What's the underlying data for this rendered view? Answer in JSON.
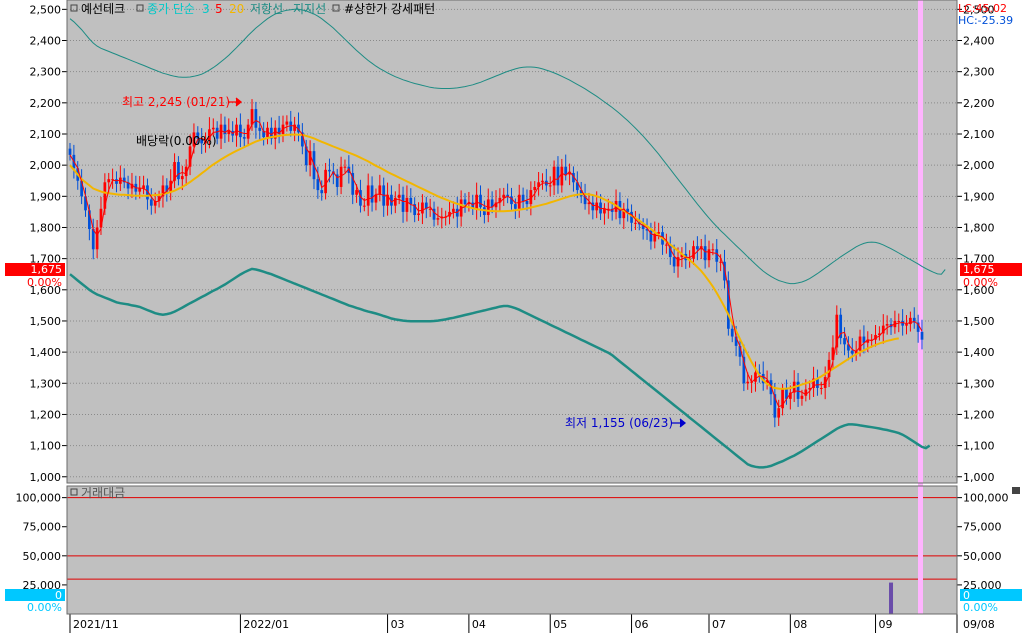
{
  "legend": {
    "title": "예선테크",
    "ma_label": "종가 단순",
    "ma_periods": [
      "3",
      "5",
      "20"
    ],
    "resistance": "저항선",
    "support": "지지선",
    "pattern": "#상한가 강세패턴"
  },
  "readout": {
    "lc": "LC:45.02",
    "hc": "HC:-25.39"
  },
  "current_price": {
    "value": "1,675",
    "change": "0.00%"
  },
  "annotations": {
    "high": "최고 2,245 (01/21)",
    "low": "최저 1,155 (06/23)",
    "dividend": "배당락(0.00%)"
  },
  "sub_panel": {
    "title": "거래대금",
    "current_value": "0",
    "current_change": "0.00%"
  },
  "colors": {
    "background": "#c0c0c0",
    "up": "#ff0000",
    "down": "#0050d8",
    "ma3": "#ff0000",
    "ma20": "#f2b600",
    "band": "#1e8c84",
    "highlight": "#ffb4ff",
    "price_tag": "#ff0000",
    "sub_tag": "#00c8ff"
  },
  "chart_data": [
    {
      "type": "candlestick",
      "title": "예선테크",
      "ylim": [
        980,
        2530
      ],
      "y_ticks": [
        "2,500",
        "2,400",
        "2,300",
        "2,200",
        "2,100",
        "2,000",
        "1,900",
        "1,800",
        "1,700",
        "1,600",
        "1,500",
        "1,400",
        "1,300",
        "1,200",
        "1,100",
        "1,000"
      ],
      "x_ticks": [
        "2021/11",
        "2022/01",
        "03",
        "04",
        "05",
        "06",
        "07",
        "08",
        "09",
        "09/08"
      ],
      "dates": [
        "2021-11-01",
        "2021-11-02",
        "2021-11-03",
        "2021-11-04",
        "2021-11-05",
        "2021-11-08",
        "2021-11-09",
        "2021-11-10",
        "2021-11-11",
        "2021-11-12",
        "2021-11-15",
        "2021-11-16",
        "2021-11-17",
        "2021-11-18",
        "2021-11-19",
        "2021-11-22",
        "2021-11-23",
        "2021-11-24",
        "2021-11-25",
        "2021-11-26",
        "2021-11-29",
        "2021-11-30",
        "2021-12-01",
        "2021-12-02",
        "2021-12-03",
        "2021-12-06",
        "2021-12-07",
        "2021-12-08",
        "2021-12-09",
        "2021-12-10",
        "2021-12-13",
        "2021-12-14",
        "2021-12-15",
        "2021-12-16",
        "2021-12-17",
        "2021-12-20",
        "2021-12-21",
        "2021-12-22",
        "2021-12-23",
        "2021-12-24",
        "2021-12-27",
        "2021-12-28",
        "2021-12-29",
        "2021-12-30",
        "2022-01-03",
        "2022-01-04",
        "2022-01-05",
        "2022-01-06",
        "2022-01-07",
        "2022-01-10",
        "2022-01-11",
        "2022-01-12",
        "2022-01-13",
        "2022-01-14",
        "2022-01-17",
        "2022-01-18",
        "2022-01-19",
        "2022-01-20",
        "2022-01-21",
        "2022-01-24",
        "2022-01-25",
        "2022-01-26",
        "2022-01-27",
        "2022-01-28",
        "2022-02-03",
        "2022-02-04",
        "2022-02-07",
        "2022-02-08",
        "2022-02-09",
        "2022-02-10",
        "2022-02-11",
        "2022-02-14",
        "2022-02-15",
        "2022-02-16",
        "2022-02-17",
        "2022-02-18",
        "2022-02-21",
        "2022-02-22",
        "2022-02-23",
        "2022-02-24",
        "2022-02-25",
        "2022-02-28",
        "2022-03-02",
        "2022-03-03",
        "2022-03-04",
        "2022-03-07",
        "2022-03-08",
        "2022-03-10",
        "2022-03-11",
        "2022-03-14",
        "2022-03-15",
        "2022-03-16",
        "2022-03-17",
        "2022-03-18",
        "2022-03-21",
        "2022-03-22",
        "2022-03-23",
        "2022-03-24",
        "2022-03-25",
        "2022-03-28",
        "2022-03-29",
        "2022-03-30",
        "2022-03-31",
        "2022-04-01",
        "2022-04-04",
        "2022-04-05",
        "2022-04-06",
        "2022-04-07",
        "2022-04-08",
        "2022-04-11",
        "2022-04-12",
        "2022-04-13",
        "2022-04-14",
        "2022-04-15",
        "2022-04-18",
        "2022-04-19",
        "2022-04-20",
        "2022-04-21",
        "2022-04-22",
        "2022-04-25",
        "2022-04-26",
        "2022-04-27",
        "2022-04-28",
        "2022-04-29",
        "2022-05-02",
        "2022-05-03",
        "2022-05-04",
        "2022-05-06",
        "2022-05-09",
        "2022-05-10",
        "2022-05-11",
        "2022-05-12",
        "2022-05-13",
        "2022-05-16",
        "2022-05-17",
        "2022-05-18",
        "2022-05-19",
        "2022-05-20",
        "2022-05-23",
        "2022-05-24",
        "2022-05-25",
        "2022-05-26",
        "2022-05-27",
        "2022-05-30",
        "2022-05-31",
        "2022-06-02",
        "2022-06-03",
        "2022-06-07",
        "2022-06-08",
        "2022-06-09",
        "2022-06-10",
        "2022-06-13",
        "2022-06-14",
        "2022-06-15",
        "2022-06-16",
        "2022-06-17",
        "2022-06-20",
        "2022-06-21",
        "2022-06-22",
        "2022-06-23",
        "2022-06-24",
        "2022-06-27",
        "2022-06-28",
        "2022-06-29",
        "2022-06-30",
        "2022-07-01",
        "2022-07-04",
        "2022-07-05",
        "2022-07-06",
        "2022-07-07",
        "2022-07-08",
        "2022-07-11",
        "2022-07-12",
        "2022-07-13",
        "2022-07-14",
        "2022-07-15",
        "2022-07-18",
        "2022-07-19",
        "2022-07-20",
        "2022-07-21",
        "2022-07-22",
        "2022-07-25",
        "2022-07-26",
        "2022-07-27",
        "2022-07-28",
        "2022-07-29",
        "2022-08-01",
        "2022-08-02",
        "2022-08-03",
        "2022-08-04",
        "2022-08-05",
        "2022-08-08",
        "2022-08-09",
        "2022-08-10",
        "2022-08-11",
        "2022-08-12",
        "2022-08-16",
        "2022-08-17",
        "2022-08-18",
        "2022-08-19",
        "2022-08-22",
        "2022-08-23",
        "2022-08-24",
        "2022-08-25",
        "2022-08-26",
        "2022-08-29",
        "2022-08-30",
        "2022-08-31",
        "2022-09-01",
        "2022-09-02",
        "2022-09-05",
        "2022-09-06",
        "2022-09-07",
        "2022-09-08"
      ],
      "close": [
        2033,
        1990,
        1950,
        1900,
        1855,
        1795,
        1730,
        1800,
        1860,
        1945,
        1955,
        1955,
        1940,
        1960,
        1945,
        1925,
        1940,
        1915,
        1925,
        1935,
        1890,
        1870,
        1885,
        1900,
        1935,
        1915,
        1950,
        2010,
        1955,
        1965,
        1995,
        2060,
        2105,
        2085,
        2070,
        2080,
        2115,
        2120,
        2085,
        2130,
        2100,
        2110,
        2095,
        2130,
        2090,
        2085,
        2130,
        2180,
        2120,
        2110,
        2090,
        2120,
        2085,
        2120,
        2100,
        2130,
        2140,
        2110,
        2130,
        2105,
        2060,
        2000,
        2045,
        1955,
        1920,
        1910,
        1985,
        1980,
        1970,
        1930,
        1995,
        1995,
        1975,
        1905,
        1920,
        1870,
        1870,
        1935,
        1880,
        1905,
        1935,
        1870,
        1905,
        1870,
        1895,
        1905,
        1850,
        1895,
        1875,
        1840,
        1845,
        1880,
        1860,
        1860,
        1825,
        1830,
        1835,
        1835,
        1850,
        1860,
        1835,
        1890,
        1875,
        1880,
        1860,
        1905,
        1865,
        1840,
        1890,
        1865,
        1880,
        1895,
        1905,
        1900,
        1875,
        1860,
        1905,
        1885,
        1875,
        1920,
        1930,
        1945,
        1950,
        1935,
        1935,
        1995,
        1935,
        1995,
        1970,
        1975,
        1945,
        1920,
        1900,
        1875,
        1880,
        1855,
        1880,
        1845,
        1860,
        1860,
        1850,
        1885,
        1830,
        1860,
        1850,
        1815,
        1815,
        1810,
        1795,
        1790,
        1755,
        1780,
        1785,
        1745,
        1745,
        1705,
        1675,
        1705,
        1715,
        1695,
        1700,
        1740,
        1730,
        1740,
        1695,
        1730,
        1730,
        1690,
        1690,
        1630,
        1475,
        1450,
        1420,
        1385,
        1300,
        1305,
        1305,
        1335,
        1330,
        1300,
        1310,
        1265,
        1190,
        1220,
        1280,
        1250,
        1270,
        1305,
        1250,
        1260,
        1280,
        1285,
        1315,
        1285,
        1285,
        1320,
        1375,
        1415,
        1520,
        1445,
        1425,
        1405,
        1395,
        1405,
        1450,
        1430,
        1440,
        1440,
        1455,
        1460,
        1485,
        1490,
        1480,
        1500,
        1500,
        1485,
        1490,
        1510,
        1495,
        1465,
        1440
      ],
      "ma20": [
        2000,
        1985,
        1970,
        1955,
        1945,
        1935,
        1925,
        1920,
        1915,
        1912,
        1910,
        1908,
        1906,
        1905,
        1905,
        1904,
        1903,
        1902,
        1902,
        1902,
        1902,
        1903,
        1904,
        1905,
        1907,
        1910,
        1914,
        1918,
        1924,
        1930,
        1938,
        1946,
        1955,
        1964,
        1974,
        1983,
        1993,
        2002,
        2010,
        2018,
        2026,
        2033,
        2040,
        2046,
        2052,
        2058,
        2064,
        2070,
        2076,
        2080,
        2084,
        2087,
        2090,
        2092,
        2094,
        2096,
        2097,
        2098,
        2098,
        2098,
        2097,
        2094,
        2090,
        2086,
        2080,
        2075,
        2070,
        2065,
        2060,
        2055,
        2050,
        2045,
        2040,
        2035,
        2030,
        2024,
        2018,
        2012,
        2005,
        1998,
        1992,
        1985,
        1978,
        1972,
        1966,
        1960,
        1954,
        1948,
        1942,
        1936,
        1930,
        1924,
        1918,
        1912,
        1906,
        1900,
        1895,
        1890,
        1885,
        1880,
        1876,
        1872,
        1868,
        1865,
        1862,
        1859,
        1857,
        1855,
        1854,
        1853,
        1852,
        1852,
        1852,
        1853,
        1854,
        1855,
        1857,
        1859,
        1861,
        1864,
        1867,
        1870,
        1873,
        1876,
        1880,
        1884,
        1888,
        1892,
        1896,
        1900,
        1903,
        1905,
        1907,
        1907,
        1906,
        1904,
        1900,
        1896,
        1890,
        1884,
        1878,
        1870,
        1862,
        1854,
        1846,
        1838,
        1830,
        1822,
        1813,
        1804,
        1795,
        1785,
        1775,
        1765,
        1755,
        1745,
        1735,
        1725,
        1715,
        1705,
        1695,
        1685,
        1673,
        1660,
        1645,
        1628,
        1610,
        1590,
        1568,
        1545,
        1520,
        1494,
        1468,
        1442,
        1416,
        1392,
        1368,
        1346,
        1326,
        1310,
        1298,
        1290,
        1285,
        1283,
        1282,
        1283,
        1285,
        1288,
        1292,
        1296,
        1300,
        1304,
        1309,
        1315,
        1322,
        1330,
        1338,
        1346,
        1354,
        1362,
        1370,
        1378,
        1386,
        1393,
        1400,
        1406,
        1412,
        1418,
        1423,
        1428,
        1432,
        1436,
        1439,
        1442,
        1444
      ],
      "band_upper": [
        2470,
        2460,
        2448,
        2435,
        2420,
        2405,
        2392,
        2382,
        2375,
        2370,
        2365,
        2360,
        2355,
        2350,
        2345,
        2340,
        2335,
        2330,
        2325,
        2320,
        2315,
        2310,
        2305,
        2300,
        2295,
        2292,
        2288,
        2285,
        2283,
        2282,
        2282,
        2283,
        2285,
        2288,
        2292,
        2298,
        2305,
        2313,
        2322,
        2332,
        2342,
        2353,
        2365,
        2377,
        2390,
        2403,
        2416,
        2428,
        2440,
        2450,
        2460,
        2470,
        2478,
        2485,
        2490,
        2494,
        2497,
        2499,
        2500,
        2500,
        2498,
        2495,
        2490,
        2485,
        2478,
        2470,
        2460,
        2450,
        2440,
        2428,
        2416,
        2404,
        2392,
        2380,
        2368,
        2357,
        2346,
        2336,
        2327,
        2318,
        2310,
        2303,
        2296,
        2290,
        2284,
        2279,
        2274,
        2270,
        2266,
        2262,
        2259,
        2256,
        2253,
        2250,
        2248,
        2247,
        2246,
        2246,
        2246,
        2247,
        2248,
        2250,
        2252,
        2255,
        2258,
        2262,
        2266,
        2271,
        2276,
        2281,
        2286,
        2291,
        2296,
        2301,
        2305,
        2309,
        2312,
        2314,
        2315,
        2315,
        2314,
        2312,
        2309,
        2305,
        2301,
        2296,
        2291,
        2285,
        2279,
        2273,
        2266,
        2259,
        2252,
        2245,
        2237,
        2229,
        2221,
        2212,
        2203,
        2194,
        2185,
        2175,
        2165,
        2154,
        2143,
        2131,
        2119,
        2106,
        2093,
        2079,
        2065,
        2050,
        2035,
        2019,
        2003,
        1987,
        1971,
        1955,
        1939,
        1923,
        1907,
        1891,
        1875,
        1860,
        1845,
        1830,
        1816,
        1803,
        1790,
        1778,
        1766,
        1754,
        1742,
        1730,
        1718,
        1706,
        1694,
        1682,
        1671,
        1660,
        1651,
        1643,
        1636,
        1630,
        1626,
        1622,
        1620,
        1620,
        1622,
        1625,
        1630,
        1636,
        1644,
        1652,
        1661,
        1670,
        1679,
        1688,
        1697,
        1706,
        1714,
        1722,
        1730,
        1738,
        1744,
        1749,
        1752,
        1753,
        1752,
        1749,
        1744,
        1738,
        1732,
        1725,
        1718,
        1711,
        1704,
        1697,
        1690,
        1683,
        1675,
        1668,
        1662,
        1656,
        1651,
        1650,
        1665
      ],
      "band_lower": [
        1650,
        1640,
        1630,
        1620,
        1610,
        1600,
        1592,
        1585,
        1580,
        1575,
        1570,
        1565,
        1560,
        1557,
        1555,
        1553,
        1550,
        1548,
        1545,
        1540,
        1535,
        1530,
        1525,
        1522,
        1520,
        1522,
        1525,
        1530,
        1536,
        1543,
        1550,
        1557,
        1563,
        1570,
        1577,
        1583,
        1590,
        1597,
        1603,
        1610,
        1617,
        1625,
        1633,
        1641,
        1649,
        1656,
        1662,
        1667,
        1665,
        1662,
        1658,
        1654,
        1650,
        1645,
        1640,
        1635,
        1630,
        1625,
        1620,
        1615,
        1610,
        1605,
        1600,
        1595,
        1590,
        1585,
        1580,
        1575,
        1570,
        1565,
        1560,
        1555,
        1550,
        1546,
        1542,
        1538,
        1534,
        1530,
        1527,
        1524,
        1520,
        1516,
        1512,
        1508,
        1505,
        1503,
        1501,
        1500,
        1499,
        1499,
        1499,
        1499,
        1499,
        1499,
        1500,
        1501,
        1503,
        1505,
        1508,
        1510,
        1513,
        1516,
        1519,
        1522,
        1525,
        1528,
        1531,
        1534,
        1537,
        1540,
        1543,
        1546,
        1548,
        1548,
        1545,
        1541,
        1536,
        1530,
        1524,
        1518,
        1512,
        1506,
        1500,
        1494,
        1488,
        1482,
        1476,
        1470,
        1464,
        1458,
        1452,
        1446,
        1440,
        1434,
        1428,
        1422,
        1416,
        1410,
        1404,
        1398,
        1390,
        1380,
        1370,
        1360,
        1350,
        1340,
        1330,
        1320,
        1310,
        1300,
        1290,
        1280,
        1270,
        1260,
        1250,
        1240,
        1230,
        1220,
        1210,
        1200,
        1190,
        1180,
        1170,
        1160,
        1150,
        1140,
        1130,
        1120,
        1110,
        1100,
        1090,
        1080,
        1070,
        1060,
        1050,
        1040,
        1035,
        1032,
        1030,
        1030,
        1032,
        1035,
        1040,
        1045,
        1050,
        1056,
        1062,
        1068,
        1075,
        1082,
        1090,
        1098,
        1106,
        1114,
        1122,
        1130,
        1138,
        1146,
        1154,
        1160,
        1165,
        1168,
        1168,
        1167,
        1165,
        1163,
        1161,
        1159,
        1157,
        1155,
        1152,
        1150,
        1147,
        1144,
        1140,
        1135,
        1128,
        1120,
        1112,
        1104,
        1096,
        1092,
        1100
      ]
    },
    {
      "type": "bar",
      "title": "거래대금",
      "ylim": [
        0,
        110000
      ],
      "y_ticks": [
        "100,000",
        "75,000",
        "50,000",
        "25,000"
      ],
      "reference_lines": [
        100000,
        50000,
        30000
      ],
      "categories": [
        "2022-09-07"
      ],
      "values": [
        27000
      ]
    }
  ]
}
